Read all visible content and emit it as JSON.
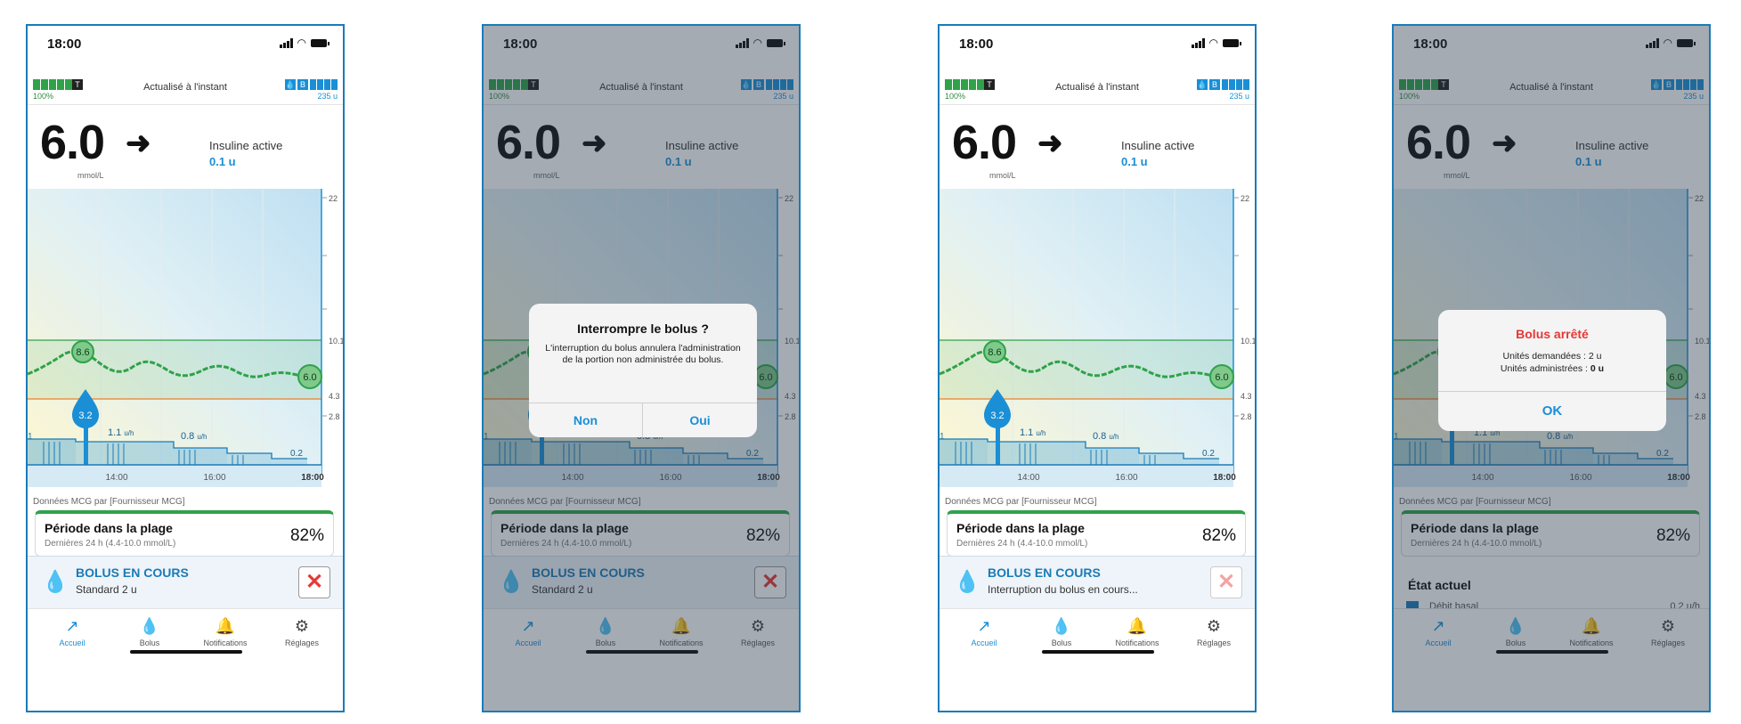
{
  "status": {
    "time": "18:00"
  },
  "device_bar": {
    "battery_pct": "100%",
    "updated": "Actualisé à l'instant",
    "reservoir_units": "235 u",
    "pump_tag": "T",
    "reservoir_tag": "B"
  },
  "glucose": {
    "value": "6.0",
    "unit": "mmol/L",
    "trend_arrow": "➜",
    "trend_icon": "arrow-right-icon",
    "active_insulin_label": "Insuline active",
    "active_insulin_value": "0.1 u"
  },
  "chart": {
    "y_ticks": [
      "22",
      "10.1",
      "4.3",
      "2.8"
    ],
    "x_ticks": [
      "14:00",
      "16:00",
      "18:00"
    ],
    "peak_label": "8.6",
    "current_label": "6.0",
    "bolus_label": "3.2",
    "basal_labels": [
      "1.1",
      "0.8",
      "0.2"
    ],
    "basal_unit": "u/h",
    "left_label": "1",
    "range_band_color": "#2fa24a",
    "low_line_color": "#ef7d2b"
  },
  "cgm_source": "Données MCG par [Fournisseur MCG]",
  "time_in_range": {
    "title": "Période dans la plage",
    "subtitle": "Dernières 24 h (4.4-10.0 mmol/L)",
    "value": "82%"
  },
  "current_state": {
    "title": "État actuel",
    "row_label": "Débit basal",
    "row_value": "0.2 u/h"
  },
  "bolus_banner": {
    "title": "BOLUS EN COURS",
    "subtitle_standard": "Standard 2 u",
    "subtitle_stopping": "Interruption du bolus en cours..."
  },
  "tabs": [
    {
      "label": "Accueil",
      "icon": "trend-chart-icon"
    },
    {
      "label": "Bolus",
      "icon": "drop-icon"
    },
    {
      "label": "Notifications",
      "icon": "bell-icon"
    },
    {
      "label": "Réglages",
      "icon": "gear-icon"
    }
  ],
  "dialog_stop": {
    "title": "Interrompre le bolus ?",
    "message": "L'interruption du bolus annulera l'administration de la portion non administrée du bolus.",
    "cancel": "Non",
    "confirm": "Oui"
  },
  "dialog_stopped": {
    "title": "Bolus arrêté",
    "requested": "Unités demandées : 2 u",
    "delivered_prefix": "Unités administrées : ",
    "delivered_value": "0 u",
    "ok": "OK"
  },
  "colors": {
    "accent": "#1a8fd6",
    "brand": "#1a7bb8",
    "alert": "#e53935",
    "range": "#2fa24a"
  }
}
